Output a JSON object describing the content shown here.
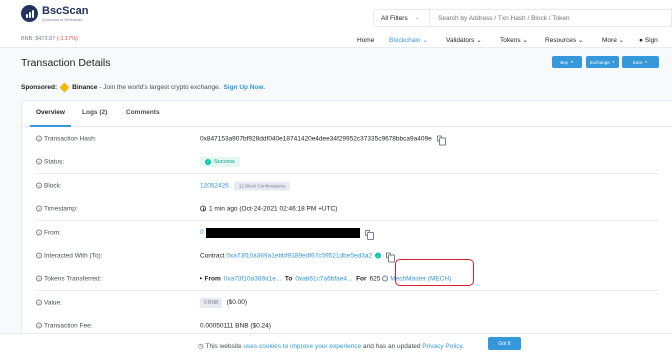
{
  "brand": {
    "name": "BscScan",
    "tagline": "A product of Etherscan"
  },
  "ticker": {
    "label": "BNB:",
    "price": "$473.87",
    "change": "(-1.17%)"
  },
  "search": {
    "filter_label": "All Filters",
    "placeholder": "Search by Address / Txn Hash / Block / Token"
  },
  "nav": {
    "items": [
      {
        "label": "Home"
      },
      {
        "label": "Blockchain"
      },
      {
        "label": "Validators"
      },
      {
        "label": "Tokens"
      },
      {
        "label": "Resources"
      },
      {
        "label": "More"
      },
      {
        "label": "Sign"
      }
    ]
  },
  "page": {
    "title": "Transaction Details",
    "buttons": {
      "buy": "Buy",
      "exchange": "Exchange",
      "earn": "Earn"
    }
  },
  "sponsor": {
    "label": "Sponsored:",
    "name": "Binance",
    "text": "- Join the world's largest crypto exchange.",
    "cta": "Sign Up Now."
  },
  "tabs": [
    "Overview",
    "Logs (2)",
    "Comments"
  ],
  "rows": {
    "hash": {
      "label": "Transaction Hash:",
      "value": "0x847153a907bf928ddf040e18741420e4dee34f29952c37335c9678bbca9a409e"
    },
    "status": {
      "label": "Status:",
      "value": "Success"
    },
    "block": {
      "label": "Block:",
      "value": "12052426",
      "confirmations": "12 Block Confirmations"
    },
    "timestamp": {
      "label": "Timestamp:",
      "value": "1 min ago (Oct-24-2021 02:46:18 PM +UTC)"
    },
    "from": {
      "label": "From:",
      "prefix": "0"
    },
    "interacted": {
      "label": "Interacted With (To):",
      "prefix": "Contract",
      "address": "0xa73f10a369a1ebbf9189edf67c09521dbe5ed3a2"
    },
    "tokens": {
      "label": "Tokens Transferred:",
      "from_label": "From",
      "from_addr": "0xa73f10a369a1e...",
      "to_label": "To",
      "to_addr": "0xab61c7a6bfae4...",
      "for_label": "For",
      "amount": "625",
      "token": "MechMaster (MECH)"
    },
    "value": {
      "label": "Value:",
      "amount": "0 BNB",
      "usd": "($0.00)"
    },
    "fee": {
      "label": "Transaction Fee:",
      "value": "0.00050111 BNB ($0.24)"
    }
  },
  "cookie": {
    "text_1": "This website",
    "link_1": "uses cookies to improve your experience",
    "text_2": "and has an updated",
    "link_2": "Privacy Policy.",
    "button": "Got It"
  }
}
